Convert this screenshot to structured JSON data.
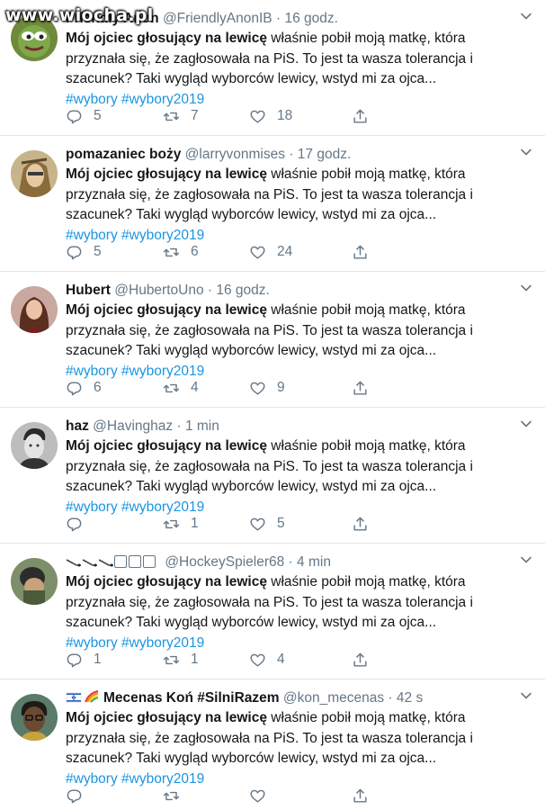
{
  "watermark": "www.wiocha.pl",
  "colors": {
    "text": "#14171a",
    "muted": "#657786",
    "link": "#1b95e0",
    "divider": "#dfe5ea"
  },
  "tweets": [
    {
      "name": "Friendly Anon",
      "handle": "@FriendlyAnonIB",
      "time": "16 godz.",
      "bold": "Mój ojciec głosujący na lewicę",
      "line1_rest": " właśnie pobił moją matkę, która",
      "line2": "przyznała się, że zagłosowała na PiS. To jest ta wasza tolerancja i",
      "line3": "szacunek? Taki wygląd wyborców lewicy, wstyd mi za ojca...",
      "hashtags": "#wybory #wybory2019",
      "replies": "5",
      "retweets": "7",
      "likes": "18",
      "avatar_icon": "avatar-icon"
    },
    {
      "name": "pomazaniec boży",
      "handle": "@larryvonmises",
      "time": "17 godz.",
      "bold": "Mój ojciec głosujący na lewicę",
      "line1_rest": " właśnie pobił moją matkę, która",
      "line2": "przyznała się, że zagłosowała na PiS. To jest ta wasza tolerancja i",
      "line3": "szacunek? Taki wygląd wyborców lewicy, wstyd mi za ojca...",
      "hashtags": "#wybory #wybory2019",
      "replies": "5",
      "retweets": "6",
      "likes": "24",
      "avatar_icon": "avatar-icon"
    },
    {
      "name": "Hubert",
      "handle": "@HubertoUno",
      "time": "16 godz.",
      "bold": "Mój ojciec głosujący na lewicę",
      "line1_rest": " właśnie pobił moją matkę, która",
      "line2": "przyznała się, że zagłosowała na PiS. To jest ta wasza tolerancja i",
      "line3": "szacunek? Taki wygląd wyborców lewicy, wstyd mi za ojca...",
      "hashtags": "#wybory #wybory2019",
      "replies": "6",
      "retweets": "4",
      "likes": "9",
      "avatar_icon": "avatar-icon"
    },
    {
      "name": "haz",
      "handle": "@Havinghaz",
      "time": "1 min",
      "bold": "Mój ojciec głosujący na lewicę",
      "line1_rest": " właśnie pobił moją matkę, która",
      "line2": "przyznała się, że zagłosowała na PiS. To jest ta wasza tolerancja i",
      "line3": "szacunek? Taki wygląd wyborców lewicy, wstyd mi za ojca...",
      "hashtags": "#wybory #wybory2019",
      "replies": "",
      "retweets": "1",
      "likes": "5",
      "avatar_icon": "avatar-icon"
    },
    {
      "name": "",
      "handle": "@HockeySpieler68",
      "time": "4 min",
      "bold": "Mój ojciec głosujący na lewicę",
      "line1_rest": " właśnie pobił moją matkę, która",
      "line2": "przyznała się, że zagłosowała na PiS. To jest ta wasza tolerancja i",
      "line3": "szacunek? Taki wygląd wyborców lewicy, wstyd mi za ojca...",
      "hashtags": "#wybory #wybory2019",
      "replies": "1",
      "retweets": "1",
      "likes": "4",
      "avatar_icon": "avatar-icon"
    },
    {
      "name": "Mecenas Koń #SilniRazem",
      "handle": "@kon_mecenas",
      "time": "42 s",
      "bold": "Mój ojciec głosujący na lewicę",
      "line1_rest": " właśnie pobił moją matkę, która",
      "line2": "przyznała się, że zagłosowała na PiS. To jest ta wasza tolerancja i",
      "line3": "szacunek? Taki wygląd wyborców lewicy, wstyd mi za ojca...",
      "hashtags": "#wybory #wybory2019",
      "replies": "",
      "retweets": "",
      "likes": "",
      "avatar_icon": "avatar-icon"
    }
  ],
  "separator_dot": "·",
  "icons": [
    "reply-icon",
    "retweet-icon",
    "like-icon",
    "share-icon",
    "chevron-down-icon"
  ]
}
